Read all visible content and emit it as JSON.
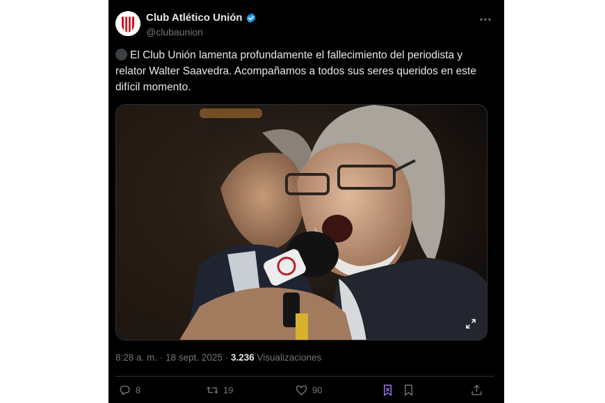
{
  "account": {
    "display_name": "Club Atlético Unión",
    "handle": "@clubaunion",
    "verified": true,
    "avatar_icon": "club-union-crest-icon"
  },
  "tweet": {
    "text": "El Club Unión lamenta profundamente el fallecimiento del periodista y relator Walter Saavedra. Acompañamos a todos sus seres queridos en este difícil momento.",
    "leading_icon": "black-circle-icon"
  },
  "meta": {
    "time": "8:28 a. m.",
    "separator": "·",
    "date": "18 sept. 2025",
    "views_count": "3.236",
    "views_label": "Visualizaciones"
  },
  "actions": {
    "replies": "8",
    "reposts": "19",
    "likes": "90"
  },
  "colors": {
    "background": "#000000",
    "text": "#e7e9ea",
    "secondary": "#71767b",
    "verified": "#1d9bf0",
    "bookmark_active": "#a07cf0"
  }
}
